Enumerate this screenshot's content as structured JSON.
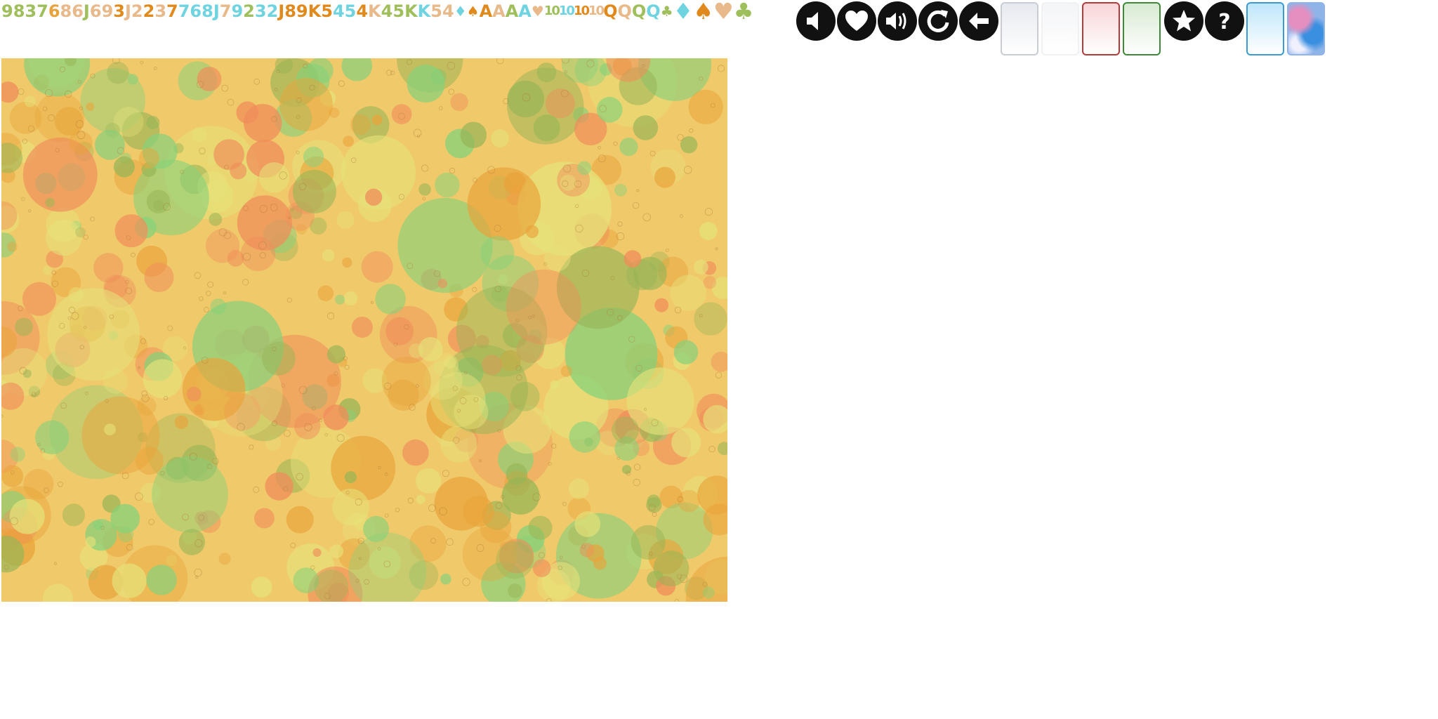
{
  "glyphs": [
    {
      "t": "9",
      "c": "#9fbf5c"
    },
    {
      "t": "8",
      "c": "#9fbf5c"
    },
    {
      "t": "3",
      "c": "#9fbf5c"
    },
    {
      "t": "7",
      "c": "#9fbf5c"
    },
    {
      "t": "6",
      "c": "#e8a23c"
    },
    {
      "t": "8",
      "c": "#e8b98a"
    },
    {
      "t": "6",
      "c": "#e8b98a"
    },
    {
      "t": "J",
      "c": "#9fbf5c"
    },
    {
      "t": "6",
      "c": "#e8b98a"
    },
    {
      "t": "9",
      "c": "#e8b98a"
    },
    {
      "t": "3",
      "c": "#e08a1e"
    },
    {
      "t": "J",
      "c": "#e8b98a"
    },
    {
      "t": "2",
      "c": "#e8b98a"
    },
    {
      "t": "2",
      "c": "#e08a1e"
    },
    {
      "t": "3",
      "c": "#e8b98a"
    },
    {
      "t": "7",
      "c": "#e08a1e"
    },
    {
      "t": "7",
      "c": "#6fd3e0"
    },
    {
      "t": "6",
      "c": "#6fd3e0"
    },
    {
      "t": "8",
      "c": "#6fd3e0"
    },
    {
      "t": "J",
      "c": "#6fd3e0"
    },
    {
      "t": "7",
      "c": "#e8b98a"
    },
    {
      "t": "9",
      "c": "#6fd3e0"
    },
    {
      "t": "2",
      "c": "#9fbf5c"
    },
    {
      "t": "3",
      "c": "#6fd3e0"
    },
    {
      "t": "2",
      "c": "#6fd3e0"
    },
    {
      "t": "J",
      "c": "#e08a1e"
    },
    {
      "t": "8",
      "c": "#e08a1e"
    },
    {
      "t": "9",
      "c": "#e08a1e"
    },
    {
      "t": "K",
      "c": "#e08a1e"
    },
    {
      "t": "5",
      "c": "#e08a1e"
    },
    {
      "t": "4",
      "c": "#6fd3e0"
    },
    {
      "t": "5",
      "c": "#6fd3e0"
    },
    {
      "t": "4",
      "c": "#e08a1e"
    },
    {
      "t": "K",
      "c": "#e8b98a"
    },
    {
      "t": "4",
      "c": "#9fbf5c"
    },
    {
      "t": "5",
      "c": "#9fbf5c"
    },
    {
      "t": "K",
      "c": "#9fbf5c"
    },
    {
      "t": "K",
      "c": "#6fd3e0"
    },
    {
      "t": "5",
      "c": "#e8b98a"
    },
    {
      "t": "4",
      "c": "#e8b98a"
    },
    {
      "s": "diamond",
      "c": "#6fd3e0",
      "z": "sm"
    },
    {
      "s": "spade",
      "c": "#e08a1e",
      "z": "sm"
    },
    {
      "t": "A",
      "c": "#e08a1e"
    },
    {
      "t": "A",
      "c": "#e8b98a"
    },
    {
      "t": "A",
      "c": "#9fbf5c"
    },
    {
      "t": "A",
      "c": "#6fd3e0"
    },
    {
      "s": "heart",
      "c": "#e8b98a",
      "z": "sm"
    },
    {
      "t": "10",
      "c": "#9fbf5c",
      "z": "tiny"
    },
    {
      "t": "10",
      "c": "#6fd3e0",
      "z": "tiny"
    },
    {
      "t": "10",
      "c": "#e08a1e",
      "z": "tiny"
    },
    {
      "t": "10",
      "c": "#e8b98a",
      "z": "tiny"
    },
    {
      "t": "Q",
      "c": "#e08a1e"
    },
    {
      "t": "Q",
      "c": "#e8b98a"
    },
    {
      "t": "Q",
      "c": "#9fbf5c"
    },
    {
      "t": "Q",
      "c": "#6fd3e0"
    },
    {
      "s": "club",
      "c": "#9fbf5c",
      "z": "sm"
    },
    {
      "s": "diamond",
      "c": "#6fd3e0",
      "z": "big"
    },
    {
      "s": "spade",
      "c": "#e08a1e",
      "z": "big"
    },
    {
      "s": "heart",
      "c": "#e8b98a",
      "z": "big"
    },
    {
      "s": "club",
      "c": "#9fbf5c",
      "z": "big"
    }
  ],
  "suit_chars": {
    "diamond": "♦",
    "spade": "♠",
    "heart": "♥",
    "club": "♣"
  },
  "buttons": [
    "sound-off-icon",
    "heart-icon",
    "sound-on-icon",
    "restart-icon",
    "back-arrow-icon",
    "star-icon",
    "help-icon"
  ],
  "cards": [
    {
      "name": "card-gray",
      "fill": "#e6e9ef",
      "edge": "#c7ccd6"
    },
    {
      "name": "card-white",
      "fill": "#f4f5f7",
      "edge": "#f0f1f3"
    },
    {
      "name": "card-red",
      "fill": "#f8d5d7",
      "edge": "#b73a3a"
    },
    {
      "name": "card-green",
      "fill": "#d8ead2",
      "edge": "#3f8a3a"
    },
    {
      "name": "card-blue",
      "fill": "#bfe6fb",
      "edge": "#3a9bd1"
    },
    {
      "name": "card-back-pattern",
      "fill": "#8fb4e8",
      "edge": "#8fb4e8"
    }
  ],
  "table": {
    "base": "#f0c96a",
    "splash": [
      "#e9a33a",
      "#97b556",
      "#f08c5a",
      "#e6e27a",
      "#86d17a"
    ]
  }
}
